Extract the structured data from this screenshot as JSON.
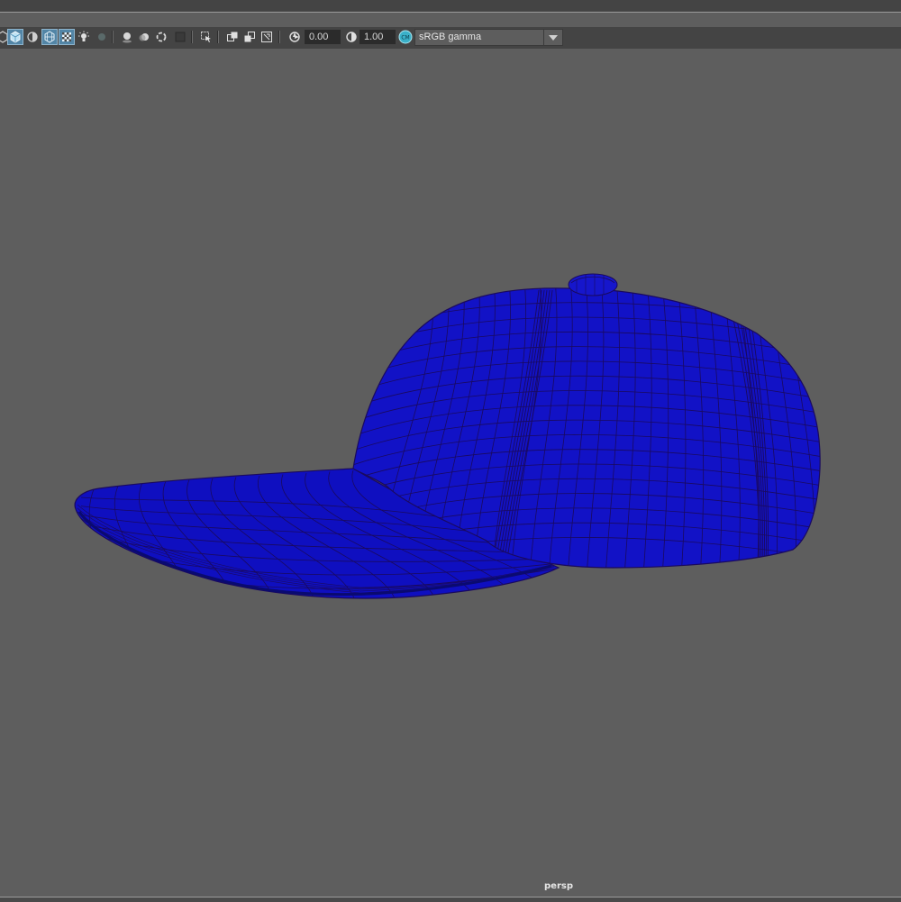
{
  "toolbar": {
    "exposure_value": "0.00",
    "gamma_value": "1.00",
    "color_space": "sRGB gamma",
    "icons": [
      "xray-icon",
      "shaded-cube-icon",
      "half-shaded-icon",
      "wireframe-on-shaded-icon",
      "textured-icon",
      "lights-icon",
      "shadows-icon",
      "ambient-occlusion-icon",
      "motion-blur-icon",
      "anti-aliasing-icon",
      "depth-of-field-icon",
      "isolate-select-icon",
      "grease-pencil-icon",
      "camera-gate-icon",
      "film-gate-icon",
      "resolution-gate-icon",
      "exposure-icon",
      "gamma-icon",
      "color-management-icon",
      "dropdown-arrow-icon"
    ]
  },
  "viewport": {
    "camera_label": "persp",
    "background_color": "#5e5e5e",
    "model_color": "#1010c8",
    "wire_color": "#1a0a5e"
  }
}
